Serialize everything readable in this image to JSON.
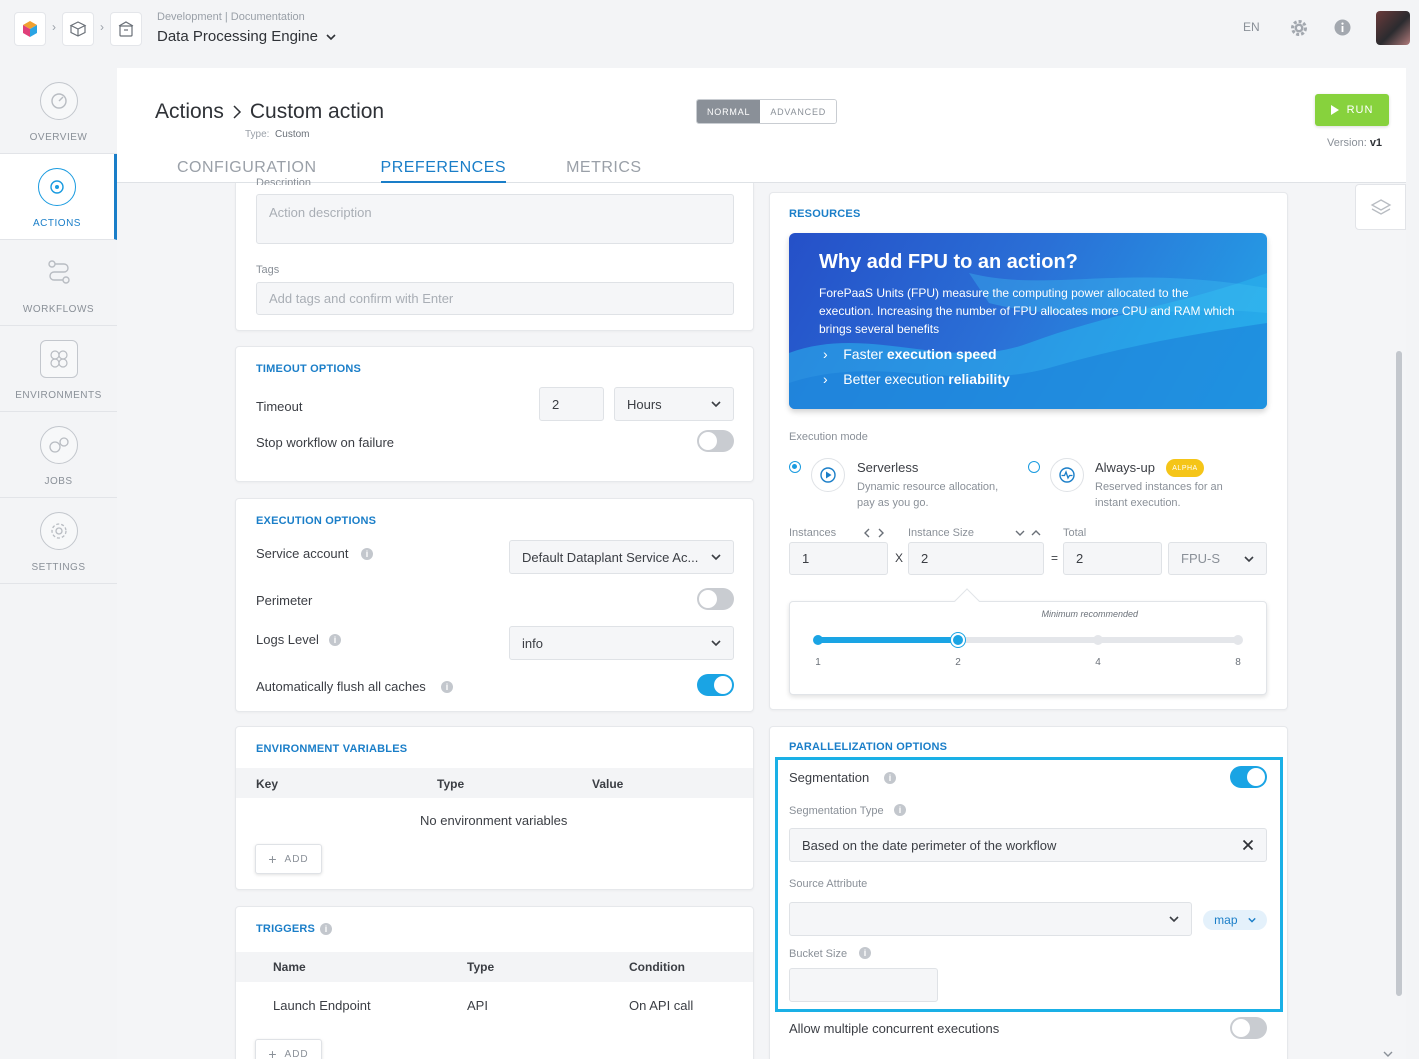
{
  "topbar": {
    "breadcrumb_sub": "Development | Documentation",
    "app_title": "Data Processing Engine",
    "lang": "EN"
  },
  "nav": {
    "items": [
      {
        "label": "OVERVIEW"
      },
      {
        "label": "ACTIONS"
      },
      {
        "label": "WORKFLOWS"
      },
      {
        "label": "ENVIRONMENTS"
      },
      {
        "label": "JOBS"
      },
      {
        "label": "SETTINGS"
      }
    ]
  },
  "header": {
    "title_parent": "Actions",
    "title_current": "Custom action",
    "type_label": "Type:",
    "type_value": "Custom",
    "mode_normal": "NORMAL",
    "mode_advanced": "ADVANCED",
    "run_label": "RUN",
    "version_label": "Version:",
    "version_value": "v1",
    "tabs": [
      {
        "label": "CONFIGURATION"
      },
      {
        "label": "PREFERENCES"
      },
      {
        "label": "METRICS"
      }
    ]
  },
  "general": {
    "description_label": "Description",
    "description_placeholder": "Action description",
    "tags_label": "Tags",
    "tags_placeholder": "Add tags and confirm with Enter"
  },
  "timeout": {
    "title": "TIMEOUT OPTIONS",
    "timeout_label": "Timeout",
    "timeout_value": "2",
    "timeout_unit": "Hours",
    "stop_label": "Stop workflow on failure"
  },
  "execution": {
    "title": "EXECUTION OPTIONS",
    "service_account_label": "Service account",
    "service_account_value": "Default Dataplant Service Ac...",
    "perimeter_label": "Perimeter",
    "logs_level_label": "Logs Level",
    "logs_level_value": "info",
    "flush_label": "Automatically flush all caches"
  },
  "env_vars": {
    "title": "ENVIRONMENT VARIABLES",
    "columns": [
      "Key",
      "Type",
      "Value"
    ],
    "empty_text": "No environment variables",
    "add_label": "ADD"
  },
  "triggers": {
    "title": "TRIGGERS",
    "columns": [
      "Name",
      "Type",
      "Condition"
    ],
    "rows": [
      [
        "Launch Endpoint",
        "API",
        "On API call"
      ]
    ],
    "add_label": "ADD"
  },
  "resources": {
    "title": "RESOURCES",
    "banner_title": "Why add FPU to an action?",
    "banner_text": "ForePaaS Units (FPU) measure the computing power allocated to the execution. Increasing the number of FPU allocates more CPU and RAM which brings several benefits",
    "bullet1_pre": "Faster ",
    "bullet1_bold": "execution speed",
    "bullet2_pre": "Better execution ",
    "bullet2_bold": "reliability",
    "execution_mode_label": "Execution mode",
    "serverless_label": "Serverless",
    "serverless_desc": "Dynamic resource allocation, pay as you go.",
    "alwaysup_label": "Always-up",
    "alwaysup_badge": "ALPHA",
    "alwaysup_desc": "Reserved instances for an instant execution.",
    "instances_label": "Instances",
    "instances_value": "1",
    "multiply": "X",
    "instance_size_label": "Instance Size",
    "instance_size_value": "2",
    "equals": "=",
    "total_label": "Total",
    "total_value": "2",
    "unit_value": "FPU-S",
    "min_recommended": "Minimum recommended",
    "slider_ticks": [
      "1",
      "2",
      "4",
      "8"
    ],
    "slider_value_index": 1
  },
  "parallel": {
    "title": "PARALLELIZATION OPTIONS",
    "segmentation_label": "Segmentation",
    "segmentation_type_label": "Segmentation Type",
    "segmentation_type_value": "Based on the date perimeter of the workflow",
    "source_attribute_label": "Source Attribute",
    "source_attribute_value": "",
    "map_label": "map",
    "bucket_size_label": "Bucket Size",
    "bucket_size_value": "",
    "concurrent_label": "Allow multiple concurrent executions"
  },
  "colors": {
    "accent": "#1a7ec8",
    "run": "#87d23d",
    "toggle_on": "#1aa4e4",
    "highlight": "#1ab0e6",
    "alpha_badge": "#f5c518"
  }
}
